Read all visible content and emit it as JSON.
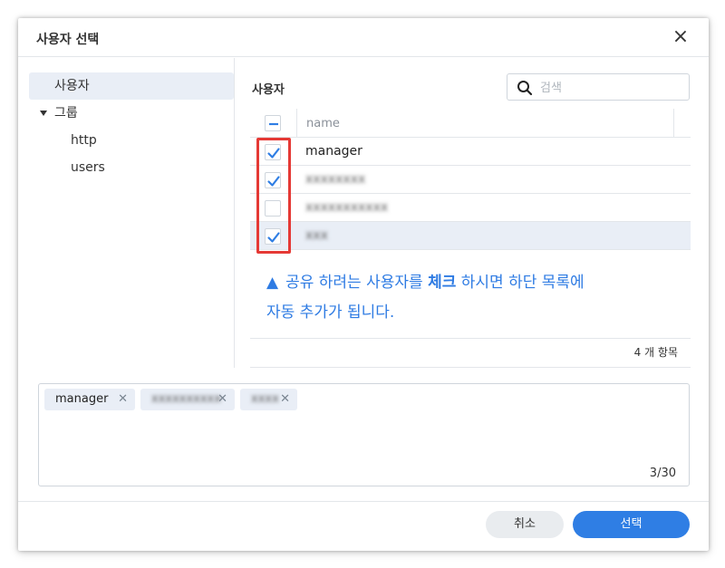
{
  "dialog": {
    "title": "사용자 선택",
    "close_glyph": "×"
  },
  "tree": {
    "items": [
      {
        "label": "사용자",
        "selected": true
      },
      {
        "label": "그룹",
        "expanded": true
      },
      {
        "label": "http"
      },
      {
        "label": "users"
      }
    ]
  },
  "panel": {
    "title": "사용자",
    "search_placeholder": "검색",
    "column_name": "name",
    "rows": [
      {
        "name": "manager",
        "checked": true,
        "blurred": false
      },
      {
        "name": "xxxxxxxx",
        "checked": true,
        "blurred": true
      },
      {
        "name": "xxxxxxxxxxx",
        "checked": false,
        "blurred": true
      },
      {
        "name": "xxx",
        "checked": true,
        "blurred": true
      }
    ],
    "annotation_line1_pre": "공유 하려는 사용자를 ",
    "annotation_bold": "체크",
    "annotation_line1_post": " 하시면 하단 목록에",
    "annotation_line2": "자동 추가가 됩니다.",
    "item_count": "4 개 항목"
  },
  "selected_tags": [
    {
      "label": "manager",
      "blurred": false
    },
    {
      "label": "xxxxxxxxxx",
      "blurred": true
    },
    {
      "label": "xxxx",
      "blurred": true
    }
  ],
  "tag_limit": "3/30",
  "footer": {
    "cancel_label": "취소",
    "ok_label": "선택"
  },
  "colors": {
    "accent": "#2f7ee4",
    "annotation": "#2e7be3",
    "highlight_box": "#e53935",
    "selected_row": "#e9eef6"
  },
  "icons": {
    "search": "search-icon",
    "close": "close-icon",
    "checkbox": "check-icon",
    "caret": "caret-down-icon",
    "tag_remove": "remove-tag-icon"
  }
}
